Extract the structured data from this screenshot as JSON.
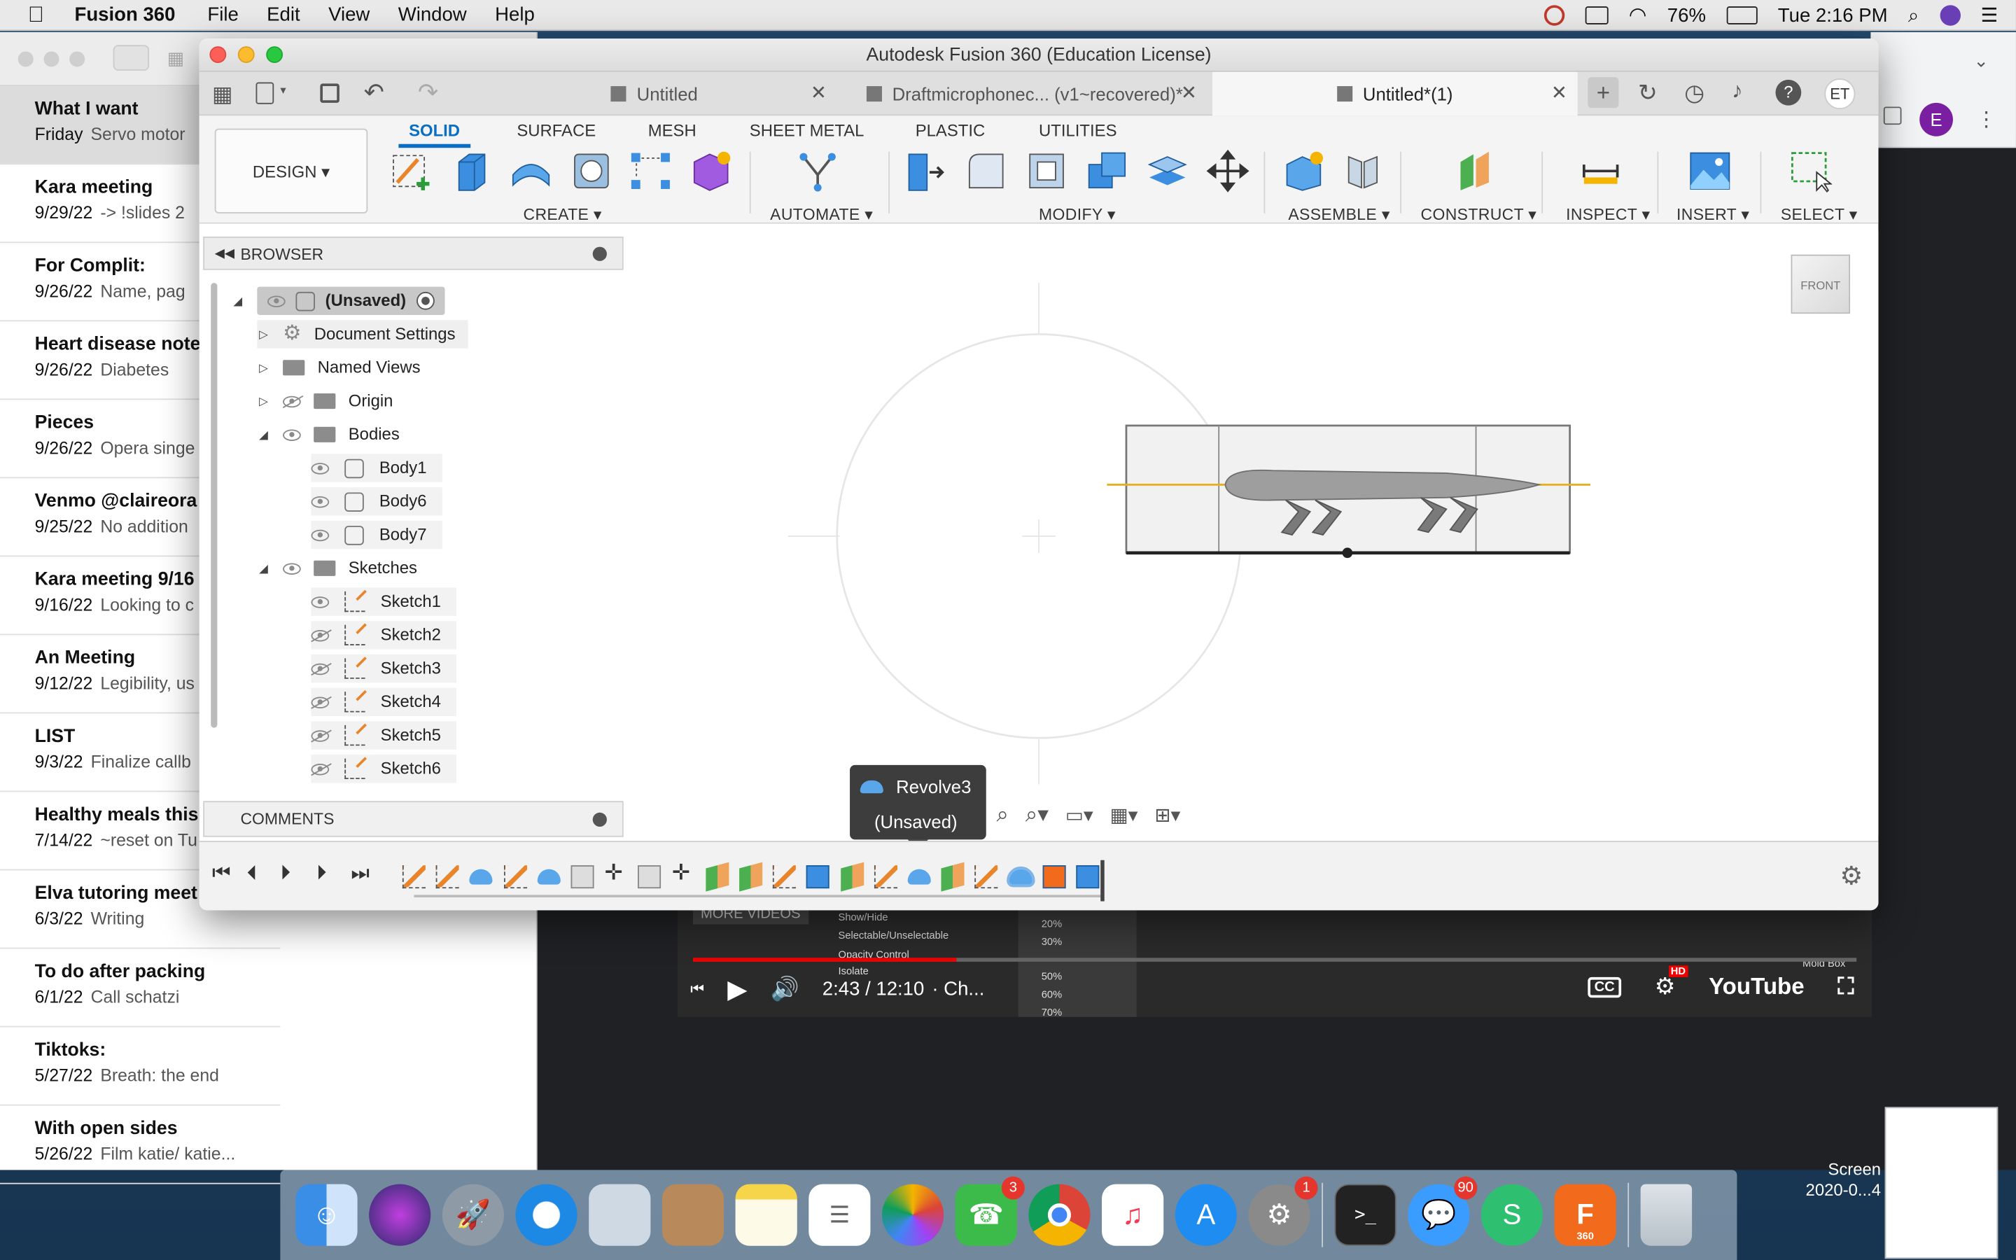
{
  "menubar": {
    "app": "Fusion 360",
    "items": [
      "File",
      "Edit",
      "View",
      "Window",
      "Help"
    ],
    "battery": "76%",
    "clock": "Tue 2:16 PM"
  },
  "notes": {
    "items": [
      {
        "title": "What I want",
        "date": "Friday",
        "snippet": "Servo motor"
      },
      {
        "title": "Kara meeting",
        "date": "9/29/22",
        "snippet": "-> !slides 2"
      },
      {
        "title": "For Complit:",
        "date": "9/26/22",
        "snippet": "Name, pag"
      },
      {
        "title": "Heart disease note",
        "date": "9/26/22",
        "snippet": "Diabetes"
      },
      {
        "title": "Pieces",
        "date": "9/26/22",
        "snippet": "Opera singe"
      },
      {
        "title": "Venmo @claireora",
        "date": "9/25/22",
        "snippet": "No addition"
      },
      {
        "title": "Kara meeting 9/16",
        "date": "9/16/22",
        "snippet": "Looking to c"
      },
      {
        "title": "An Meeting",
        "date": "9/12/22",
        "snippet": "Legibility, us"
      },
      {
        "title": "LIST",
        "date": "9/3/22",
        "snippet": "Finalize callb"
      },
      {
        "title": "Healthy meals this",
        "date": "7/14/22",
        "snippet": "~reset on Tu"
      },
      {
        "title": "Elva tutoring meet",
        "date": "6/3/22",
        "snippet": "Writing"
      },
      {
        "title": "To do after packing",
        "date": "6/1/22",
        "snippet": "Call schatzi"
      },
      {
        "title": "Tiktoks:",
        "date": "5/27/22",
        "snippet": "Breath: the end"
      },
      {
        "title": "With open sides",
        "date": "5/26/22",
        "snippet": "Film katie/ katie..."
      }
    ]
  },
  "chrome": {
    "avatar": "E"
  },
  "youtube": {
    "time": "2:43 / 12:10",
    "chapter": "· Ch...",
    "more": "MORE VIDEOS",
    "logo": "YouTube",
    "cc": "CC",
    "hd": "HD",
    "menu": [
      "Show/Hide",
      "Selectable/Unselectable",
      "Opacity Control",
      "Isolate"
    ],
    "percents": [
      "20%",
      "30%",
      "50%",
      "60%",
      "70%"
    ],
    "mold": "Mold Box"
  },
  "fusion": {
    "window_title": "Autodesk Fusion 360 (Education License)",
    "tabs": [
      {
        "label": "Untitled"
      },
      {
        "label": "Draftmicrophonec... (v1~recovered)*"
      },
      {
        "label": "Untitled*(1)"
      }
    ],
    "user_initials": "ET",
    "workspace": "DESIGN ▾",
    "ribbon_tabs": [
      "SOLID",
      "SURFACE",
      "MESH",
      "SHEET METAL",
      "PLASTIC",
      "UTILITIES"
    ],
    "groups": [
      "CREATE ▾",
      "AUTOMATE ▾",
      "MODIFY ▾",
      "ASSEMBLE ▾",
      "CONSTRUCT ▾",
      "INSPECT ▾",
      "INSERT ▾",
      "SELECT ▾"
    ],
    "browser_title": "BROWSER",
    "comments_title": "COMMENTS",
    "tree": {
      "root": "(Unsaved)",
      "document_settings": "Document Settings",
      "named_views": "Named Views",
      "origin": "Origin",
      "bodies": "Bodies",
      "body_items": [
        "Body1",
        "Body6",
        "Body7"
      ],
      "sketches": "Sketches",
      "sketch_items": [
        "Sketch1",
        "Sketch2",
        "Sketch3",
        "Sketch4",
        "Sketch5",
        "Sketch6"
      ]
    },
    "viewcube": "FRONT",
    "tooltip": {
      "feature": "Revolve3",
      "status": "(Unsaved)"
    }
  },
  "dock": {
    "badges": {
      "facetime": "3",
      "prefs": "1",
      "messages": "90"
    },
    "fusion_label": "360"
  },
  "screenshot_label": "Screen\n2020-0...4",
  "colors": {
    "accent": "#0a6fc2",
    "sketch_orange": "#e8842a",
    "selection_yellow": "#e8b020"
  }
}
